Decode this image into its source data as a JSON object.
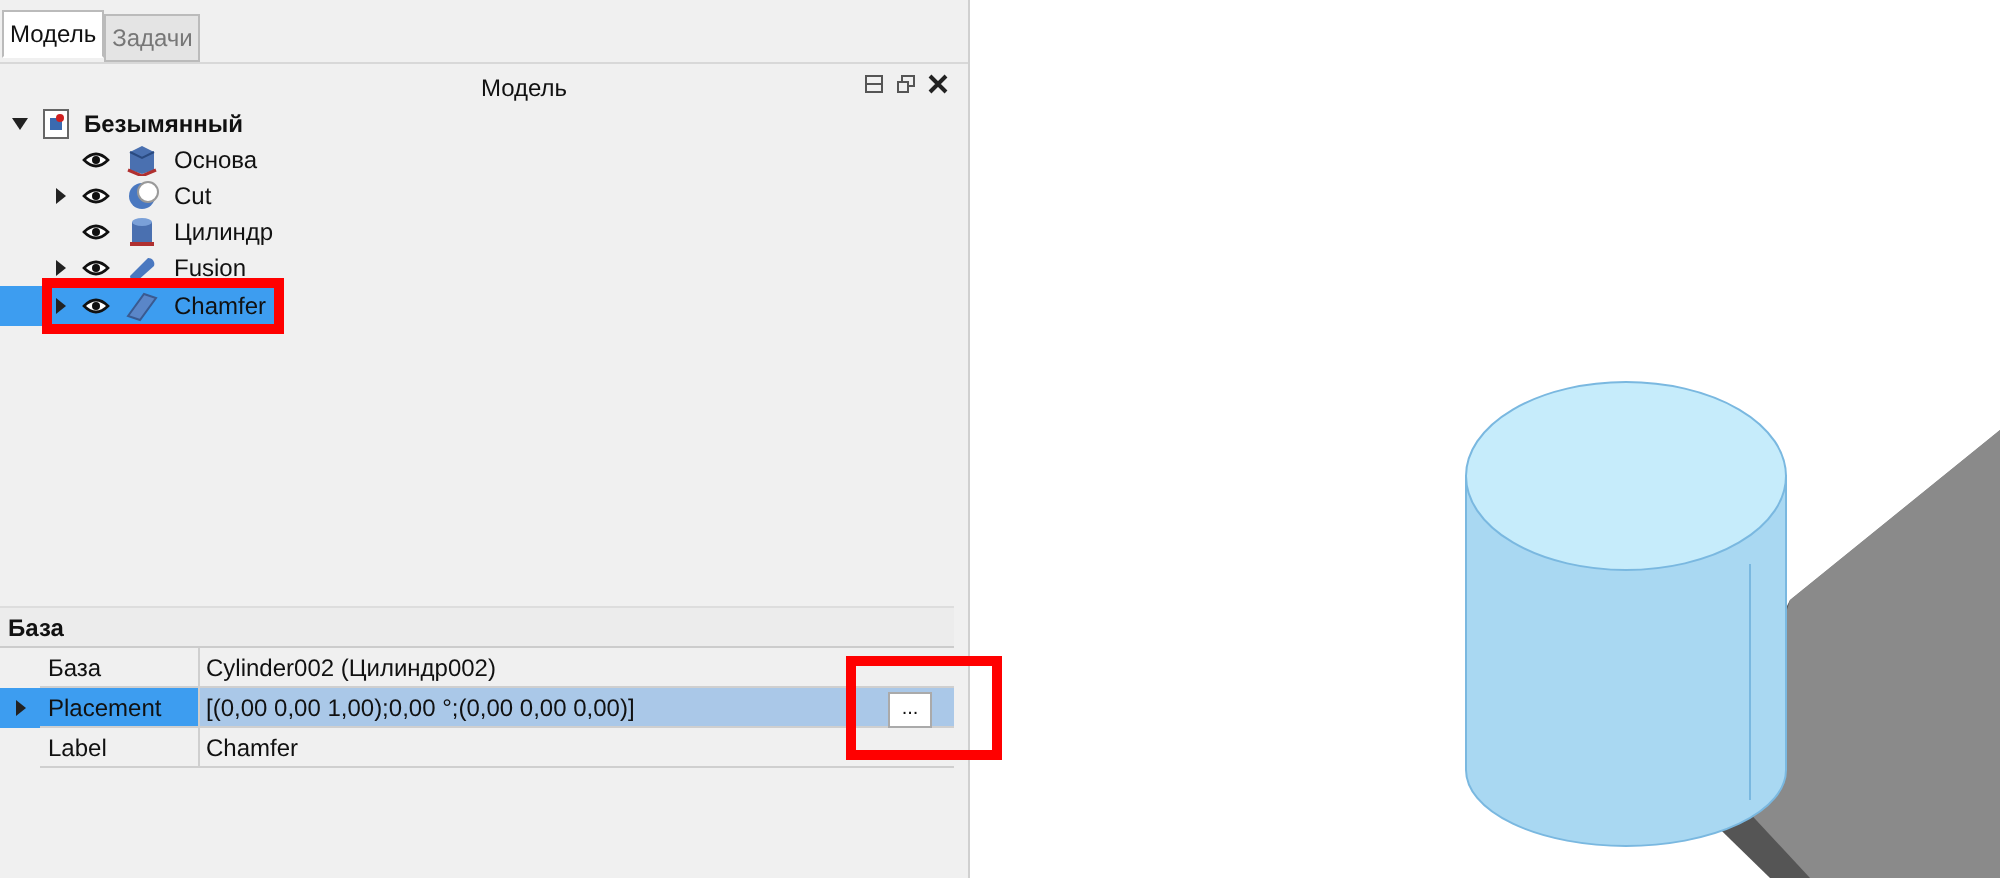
{
  "tabs": [
    {
      "label": "Модель",
      "selected": true
    },
    {
      "label": "Задачи",
      "selected": false
    }
  ],
  "tree_panel": {
    "title": "Модель"
  },
  "tree": [
    {
      "label": "Безымянный",
      "kind": "document",
      "expanded": true,
      "selected": false,
      "highlighted": false,
      "children": [
        {
          "label": "Основа",
          "kind": "box",
          "visible": true,
          "selected": false,
          "highlighted": false
        },
        {
          "label": "Cut",
          "kind": "cut",
          "visible": true,
          "expanded": false,
          "selected": false,
          "highlighted": false
        },
        {
          "label": "Цилиндр",
          "kind": "cylinder",
          "visible": true,
          "selected": false,
          "highlighted": false
        },
        {
          "label": "Fusion",
          "kind": "fusion",
          "visible": true,
          "expanded": false,
          "selected": false,
          "highlighted": false
        },
        {
          "label": "Chamfer",
          "kind": "chamfer",
          "visible": true,
          "expanded": false,
          "selected": true,
          "highlighted": true
        }
      ]
    }
  ],
  "properties": {
    "group": "База",
    "rows": [
      {
        "name": "База",
        "value": "Cylinder002 (Цилиндр002)",
        "selected": false
      },
      {
        "name": "Placement",
        "value": "[(0,00 0,00 1,00);0,00 °;(0,00 0,00 0,00)]",
        "selected": true,
        "expanded": false,
        "button": "...",
        "button_highlighted": true
      },
      {
        "name": "Label",
        "value": "Chamfer",
        "selected": false
      }
    ]
  }
}
